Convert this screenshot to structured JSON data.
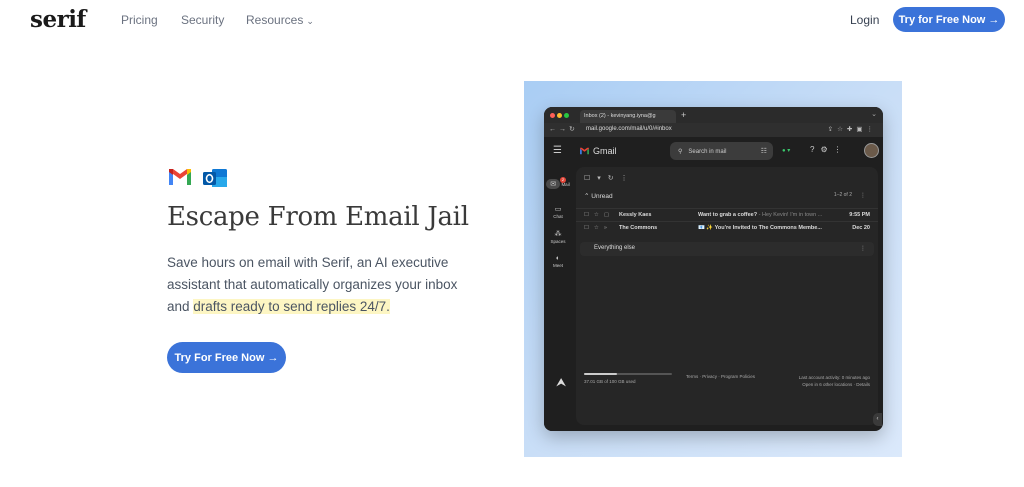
{
  "nav": {
    "logo": "serif",
    "links": [
      "Pricing",
      "Security",
      "Resources"
    ],
    "login": "Login",
    "cta": "Try for Free Now →"
  },
  "hero": {
    "title": "Escape From Email Jail",
    "body_prefix": "Save hours on email with Serif, an AI executive assistant that automatically organizes your inbox and ",
    "body_highlight": "drafts ready to send replies 24/7.",
    "cta": "Try For Free Now →",
    "accent_color": "#3b73d9",
    "highlight_color": "#fdf6c3"
  },
  "browser": {
    "tab_title": "Inbox (2) - kevinyang.iyna@g",
    "url": "mail.google.com/mail/u/0/#inbox",
    "app_name": "Gmail",
    "search_placeholder": "Search in mail",
    "rail": [
      {
        "icon": "mail-icon",
        "label": "Mail",
        "badge": "2"
      },
      {
        "icon": "chat-icon",
        "label": "Chat"
      },
      {
        "icon": "spaces-icon",
        "label": "Spaces"
      },
      {
        "icon": "meet-icon",
        "label": "Meet"
      }
    ],
    "section_unread": "Unread",
    "unread_count": "1–2 of 2",
    "emails": [
      {
        "sender": "Kessly Kaes",
        "subject": "Want to grab a coffee?",
        "snippet": " - Hey Kevin! I'm in town ...",
        "time": "9:55 PM"
      },
      {
        "sender": "The Commons",
        "subject": "📧 ✨ You're Invited to The Commons Membe...",
        "snippet": "",
        "time": "Dec 20"
      }
    ],
    "section_else": "Everything else",
    "storage_text": "37.01 GB of 100 GB used",
    "storage_fraction": 0.37,
    "footer_links": "Terms · Privacy · Program Policies",
    "activity_line1": "Last account activity: 0 minutes ago",
    "activity_line2": "Open in 6 other locations · Details"
  }
}
